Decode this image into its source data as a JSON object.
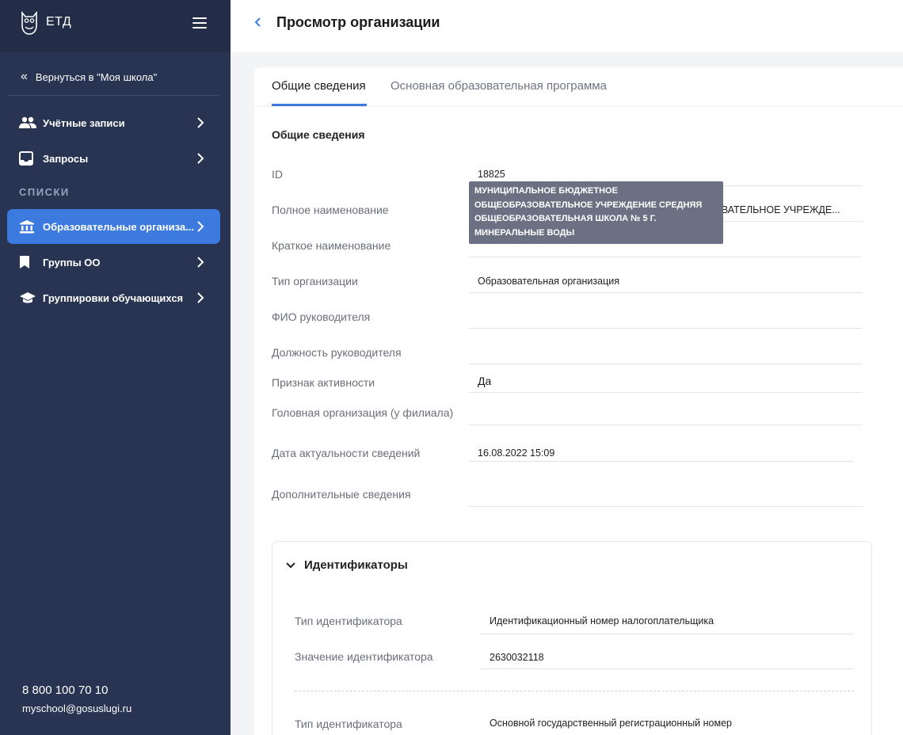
{
  "brand": {
    "name": "ЕТД"
  },
  "sidebar": {
    "back_label": "Вернуться в \"Моя школа\"",
    "section_label": "СПИСКИ",
    "items": [
      {
        "label": "Учётные записи",
        "icon": "users-icon"
      },
      {
        "label": "Запросы",
        "icon": "inbox-icon"
      },
      {
        "label": "Образовательные организа...",
        "icon": "institution-icon",
        "active": true
      },
      {
        "label": "Группы ОО",
        "icon": "bookmark-icon"
      },
      {
        "label": "Группировки обучающихся",
        "icon": "graduation-cap-icon"
      }
    ],
    "contact": {
      "phone": "8 800 100 70 10",
      "email": "myschool@gosuslugi.ru"
    }
  },
  "header": {
    "title": "Просмотр организации"
  },
  "tabs": [
    {
      "label": "Общие сведения",
      "active": true
    },
    {
      "label": "Основная образовательная программа",
      "active": false
    }
  ],
  "general": {
    "title": "Общие сведения",
    "fields": [
      {
        "label": "ID",
        "value": "18825"
      },
      {
        "label": "Полное наименование",
        "value": "ОВАТЕЛЬНОЕ УЧРЕЖДЕ..."
      },
      {
        "label": "Краткое наименование",
        "value": ""
      },
      {
        "label": "Тип организации",
        "value": "Образовательная организация"
      },
      {
        "label": "ФИО руководителя",
        "value": ""
      },
      {
        "label": "Должность руководителя",
        "value": ""
      },
      {
        "label": "Признак активности",
        "value": "Да"
      },
      {
        "label": "Головная организация (у филиала)",
        "value": ""
      },
      {
        "label": "Дата актуальности сведений",
        "value": "16.08.2022 15:09"
      },
      {
        "label": "Дополнительные сведения",
        "value": ""
      }
    ]
  },
  "tooltip": {
    "text": "МУНИЦИПАЛЬНОЕ БЮДЖЕТНОЕ ОБЩЕОБРАЗОВАТЕЛЬНОЕ УЧРЕЖДЕНИЕ СРЕДНЯЯ ОБЩЕОБРАЗОВАТЕЛЬНАЯ ШКОЛА № 5 Г. МИНЕРАЛЬНЫЕ ВОДЫ"
  },
  "identifiers": {
    "title": "Идентификаторы",
    "items": [
      {
        "type_label": "Тип идентификатора",
        "type_value": "Идентификационный номер налогоплательщика",
        "value_label": "Значение идентификатора",
        "value": "2630032118"
      },
      {
        "type_label": "Тип идентификатора",
        "type_value": "Основной государственный регистрационный номер"
      }
    ]
  },
  "colors": {
    "sidebar_bg": "#283452",
    "accent": "#3d7ae0",
    "tooltip_bg": "#6b7182"
  }
}
